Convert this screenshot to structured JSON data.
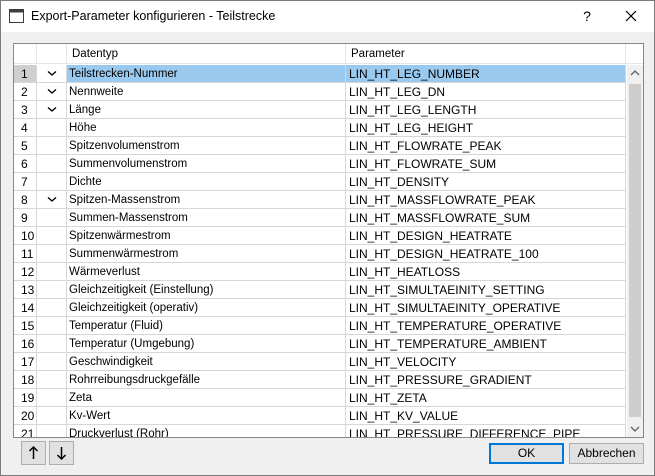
{
  "window": {
    "title": "Export-Parameter konfigurieren - Teilstrecke",
    "help_label": "?"
  },
  "grid": {
    "columns": [
      "",
      "",
      "Datentyp",
      "Parameter"
    ],
    "rows": [
      {
        "num": "1",
        "checked": true,
        "datentyp": "Teilstrecken-Nummer",
        "parameter": "LIN_HT_LEG_NUMBER",
        "selected": true
      },
      {
        "num": "2",
        "checked": true,
        "datentyp": "Nennweite",
        "parameter": "LIN_HT_LEG_DN"
      },
      {
        "num": "3",
        "checked": true,
        "datentyp": "Länge",
        "parameter": "LIN_HT_LEG_LENGTH"
      },
      {
        "num": "4",
        "checked": false,
        "datentyp": "Höhe",
        "parameter": "LIN_HT_LEG_HEIGHT"
      },
      {
        "num": "5",
        "checked": false,
        "datentyp": "Spitzenvolumenstrom",
        "parameter": "LIN_HT_FLOWRATE_PEAK"
      },
      {
        "num": "6",
        "checked": false,
        "datentyp": "Summenvolumenstrom",
        "parameter": "LIN_HT_FLOWRATE_SUM"
      },
      {
        "num": "7",
        "checked": false,
        "datentyp": "Dichte",
        "parameter": "LIN_HT_DENSITY"
      },
      {
        "num": "8",
        "checked": true,
        "datentyp": "Spitzen-Massenstrom",
        "parameter": "LIN_HT_MASSFLOWRATE_PEAK"
      },
      {
        "num": "9",
        "checked": false,
        "datentyp": "Summen-Massenstrom",
        "parameter": "LIN_HT_MASSFLOWRATE_SUM"
      },
      {
        "num": "10",
        "checked": false,
        "datentyp": "Spitzenwärmestrom",
        "parameter": "LIN_HT_DESIGN_HEATRATE"
      },
      {
        "num": "11",
        "checked": false,
        "datentyp": "Summenwärmestrom",
        "parameter": "LIN_HT_DESIGN_HEATRATE_100"
      },
      {
        "num": "12",
        "checked": false,
        "datentyp": "Wärmeverlust",
        "parameter": "LIN_HT_HEATLOSS"
      },
      {
        "num": "13",
        "checked": false,
        "datentyp": "Gleichzeitigkeit (Einstellung)",
        "parameter": "LIN_HT_SIMULTAEINITY_SETTING"
      },
      {
        "num": "14",
        "checked": false,
        "datentyp": "Gleichzeitigkeit (operativ)",
        "parameter": "LIN_HT_SIMULTAEINITY_OPERATIVE"
      },
      {
        "num": "15",
        "checked": false,
        "datentyp": "Temperatur (Fluid)",
        "parameter": "LIN_HT_TEMPERATURE_OPERATIVE"
      },
      {
        "num": "16",
        "checked": false,
        "datentyp": "Temperatur (Umgebung)",
        "parameter": "LIN_HT_TEMPERATURE_AMBIENT"
      },
      {
        "num": "17",
        "checked": false,
        "datentyp": "Geschwindigkeit",
        "parameter": "LIN_HT_VELOCITY"
      },
      {
        "num": "18",
        "checked": false,
        "datentyp": "Rohrreibungsdruckgefälle",
        "parameter": "LIN_HT_PRESSURE_GRADIENT"
      },
      {
        "num": "19",
        "checked": false,
        "datentyp": "Zeta",
        "parameter": "LIN_HT_ZETA"
      },
      {
        "num": "20",
        "checked": false,
        "datentyp": "Kv-Wert",
        "parameter": "LIN_HT_KV_VALUE"
      },
      {
        "num": "21",
        "checked": false,
        "datentyp": "Druckverlust (Rohr)",
        "parameter": "LIN_HT_PRESSURE_DIFFERENCE_PIPE"
      }
    ]
  },
  "buttons": {
    "ok": "OK",
    "cancel": "Abbrechen",
    "move_up_icon": "arrow-up-icon",
    "move_down_icon": "arrow-down-icon"
  },
  "colors": {
    "selection": "#99c9ef",
    "ok_border": "#0078d7"
  }
}
